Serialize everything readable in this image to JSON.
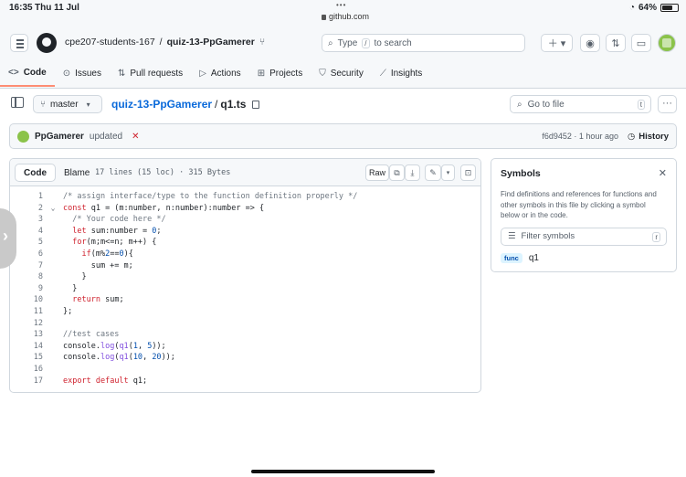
{
  "status": {
    "time": "16:35",
    "date": "Thu 11 Jul",
    "url": "github.com",
    "battery": "64%",
    "battery_level": 0.64
  },
  "header": {
    "owner": "cpe207-students-167",
    "separator": "/",
    "repo": "quiz-13-PpGamerer",
    "search_placeholder": "Type / to search",
    "search_prefix": "Type",
    "search_key": "/",
    "search_suffix": "to search"
  },
  "nav": {
    "tabs": [
      {
        "label": "Code",
        "icon": "code-icon"
      },
      {
        "label": "Issues",
        "icon": "issue-icon"
      },
      {
        "label": "Pull requests",
        "icon": "pull-request-icon"
      },
      {
        "label": "Actions",
        "icon": "play-icon"
      },
      {
        "label": "Projects",
        "icon": "table-icon"
      },
      {
        "label": "Security",
        "icon": "shield-icon"
      },
      {
        "label": "Insights",
        "icon": "graph-icon"
      }
    ]
  },
  "file": {
    "branch": "master",
    "repo_link": "quiz-13-PpGamerer",
    "path_sep": "/",
    "filename": "q1.ts",
    "goto_placeholder": "Go to file",
    "goto_key": "t"
  },
  "commit": {
    "author": "PpGamerer",
    "message": "updated",
    "status": "✕",
    "sha_time": "f6d9452 · 1 hour ago",
    "history": "History"
  },
  "code_view": {
    "tab_code": "Code",
    "tab_blame": "Blame",
    "info": "17 lines (15 loc) · 315 Bytes",
    "raw": "Raw",
    "lines": [
      "/* assign interface/type to the function definition properly */",
      "const q1 = (m:number, n:number):number => {",
      "  /* Your code here */",
      "  let sum:number = 0;",
      "  for(m;m<=n; m++) {",
      "    if(m%2==0){",
      "      sum += m;",
      "    }",
      "  }",
      "  return sum;",
      "};",
      "",
      "//test cases",
      "console.log(q1(1, 5));",
      "console.log(q1(10, 20));",
      "",
      "export default q1;"
    ]
  },
  "symbols": {
    "title": "Symbols",
    "description": "Find definitions and references for functions and other symbols in this file by clicking a symbol below or in the code.",
    "filter_placeholder": "Filter symbols",
    "filter_key": "r",
    "items": [
      {
        "kind": "func",
        "name": "q1"
      }
    ]
  }
}
